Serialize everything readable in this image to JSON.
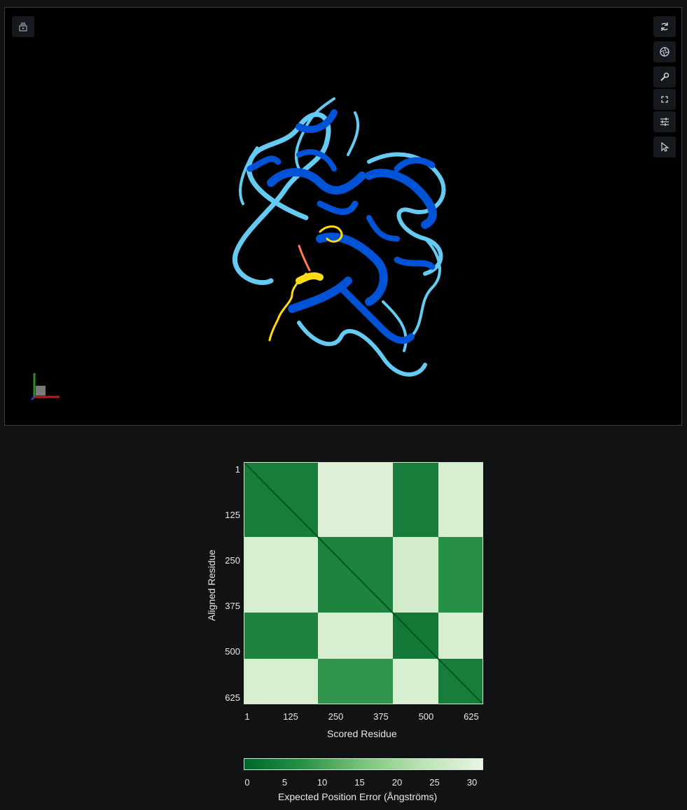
{
  "viewer": {
    "icons": {
      "left_top": "animation-panel-icon",
      "rotate": "refresh-icon",
      "screenshot": "camera-aperture-icon",
      "tools": "wrench-icon",
      "fullscreen": "expand-icon",
      "settings": "sliders-icon",
      "select": "pointer-icon"
    },
    "colors": {
      "very_high": "#0053d6",
      "confident": "#65cbf3",
      "low": "#ffdb13",
      "very_low": "#ff7d45"
    }
  },
  "pae": {
    "y_axis_label": "Aligned Residue",
    "x_axis_label": "Scored Residue",
    "colorbar_label": "Expected Position Error (Ångströms)",
    "colorbar_ticks": [
      "0",
      "5",
      "10",
      "15",
      "20",
      "25",
      "30"
    ]
  },
  "chart_data": {
    "type": "heatmap",
    "title": "",
    "xlabel": "Scored Residue",
    "ylabel": "Aligned Residue",
    "x_ticks": [
      "1",
      "125",
      "250",
      "375",
      "500",
      "625"
    ],
    "y_ticks": [
      "1",
      "125",
      "250",
      "375",
      "500",
      "625"
    ],
    "x_range": [
      1,
      660
    ],
    "y_range": [
      1,
      660
    ],
    "color_range": [
      0,
      30
    ],
    "domain_boundaries": [
      1,
      205,
      411,
      537,
      660
    ],
    "block_mean_error": [
      [
        4,
        28,
        4,
        27
      ],
      [
        27,
        5,
        26,
        7
      ],
      [
        5,
        27,
        3,
        27
      ],
      [
        27,
        8,
        27,
        4
      ]
    ]
  }
}
